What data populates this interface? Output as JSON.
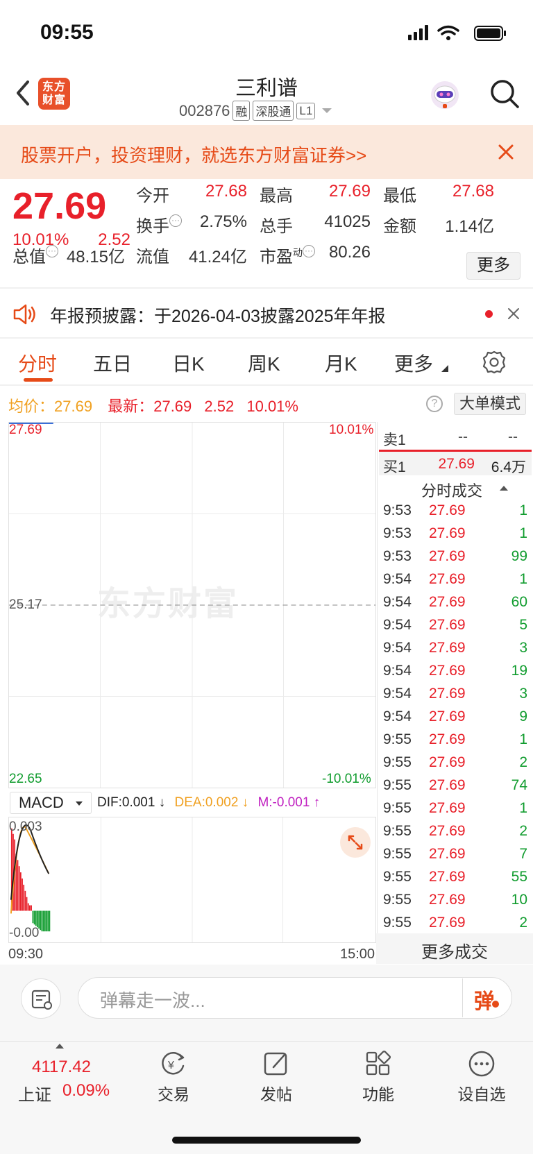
{
  "status_bar": {
    "time": "09:55"
  },
  "header": {
    "logo_text": "东方财富",
    "stock_name": "三利谱",
    "stock_code": "002876",
    "tags": [
      "融",
      "深股通",
      "L1"
    ]
  },
  "banner": {
    "text": "股票开户，投资理财，就选东方财富证券>>"
  },
  "quote": {
    "price": "27.69",
    "change_pct": "10.01%",
    "change": "2.52",
    "fields": [
      {
        "label": "今开",
        "value": "27.68",
        "color": "#e8202a"
      },
      {
        "label": "最高",
        "value": "27.69",
        "color": "#e8202a"
      },
      {
        "label": "最低",
        "value": "27.68",
        "color": "#e8202a"
      },
      {
        "label": "换手",
        "value": "2.75%",
        "color": "#333333"
      },
      {
        "label": "总手",
        "value": "41025",
        "color": "#333333"
      },
      {
        "label": "金额",
        "value": "1.14亿",
        "color": "#333333"
      },
      {
        "label": "流值",
        "value": "41.24亿",
        "color": "#333333"
      }
    ],
    "total_value_label": "总值",
    "total_value": "48.15亿",
    "pe_label": "市盈",
    "pe_sup": "动",
    "pe_value": "80.26",
    "more_label": "更多"
  },
  "notice": {
    "text": "年报预披露：于2026-04-03披露2025年年报"
  },
  "tabs": [
    "分时",
    "五日",
    "日K",
    "周K",
    "月K",
    "更多"
  ],
  "chart_header": {
    "avg_label": "均价：",
    "avg_value": "27.69",
    "latest_label": "最新：",
    "latest_value": "27.69",
    "latest_change": "2.52",
    "latest_pct": "10.01%",
    "help": "?",
    "big_order_label": "大单模式"
  },
  "chart_data": {
    "type": "line",
    "y_labels": {
      "top": "27.69",
      "mid": "25.17",
      "bottom": "22.65"
    },
    "pct_labels": {
      "top": "10.01%",
      "bottom": "-10.01%"
    },
    "ylim": [
      22.65,
      27.69
    ],
    "x_labels": [
      "09:30",
      "15:00"
    ],
    "watermark": "东方财富",
    "series": [
      {
        "values": [
          27.69,
          27.69,
          27.69,
          27.69
        ]
      }
    ]
  },
  "macd": {
    "select_label": "MACD",
    "dif": "DIF:0.001 ↓",
    "dea": "DEA:0.002 ↓",
    "m": "M:-0.001 ↑",
    "top_label": "0.003",
    "bottom_label": "-0.00",
    "colors": {
      "dif": "#111111",
      "dea": "#f0a020",
      "up": "#e8202a",
      "down": "#109c2e"
    }
  },
  "order_book": {
    "sell1": {
      "label": "卖1",
      "price": "--",
      "vol": "--"
    },
    "buy1": {
      "label": "买1",
      "price": "27.69",
      "vol": "6.4万"
    }
  },
  "trades_title": "分时成交",
  "trades": [
    {
      "t": "9:53",
      "p": "27.69",
      "v": "1"
    },
    {
      "t": "9:53",
      "p": "27.69",
      "v": "1"
    },
    {
      "t": "9:53",
      "p": "27.69",
      "v": "99"
    },
    {
      "t": "9:54",
      "p": "27.69",
      "v": "1"
    },
    {
      "t": "9:54",
      "p": "27.69",
      "v": "60"
    },
    {
      "t": "9:54",
      "p": "27.69",
      "v": "5"
    },
    {
      "t": "9:54",
      "p": "27.69",
      "v": "3"
    },
    {
      "t": "9:54",
      "p": "27.69",
      "v": "19"
    },
    {
      "t": "9:54",
      "p": "27.69",
      "v": "3"
    },
    {
      "t": "9:54",
      "p": "27.69",
      "v": "9"
    },
    {
      "t": "9:55",
      "p": "27.69",
      "v": "1"
    },
    {
      "t": "9:55",
      "p": "27.69",
      "v": "2"
    },
    {
      "t": "9:55",
      "p": "27.69",
      "v": "74"
    },
    {
      "t": "9:55",
      "p": "27.69",
      "v": "1"
    },
    {
      "t": "9:55",
      "p": "27.69",
      "v": "2"
    },
    {
      "t": "9:55",
      "p": "27.69",
      "v": "7"
    },
    {
      "t": "9:55",
      "p": "27.69",
      "v": "55"
    },
    {
      "t": "9:55",
      "p": "27.69",
      "v": "10"
    },
    {
      "t": "9:55",
      "p": "27.69",
      "v": "2"
    }
  ],
  "more_trades_label": "更多成交",
  "danmu": {
    "placeholder": "弹幕走一波...",
    "button": "弹"
  },
  "bottom_nav": {
    "index_value": "4117.42",
    "index_name": "上证",
    "index_pct": "0.09%",
    "items": [
      {
        "label": "交易",
        "icon": "trade-icon"
      },
      {
        "label": "发帖",
        "icon": "post-icon"
      },
      {
        "label": "功能",
        "icon": "function-icon"
      },
      {
        "label": "设自选",
        "icon": "watchlist-icon"
      }
    ]
  }
}
